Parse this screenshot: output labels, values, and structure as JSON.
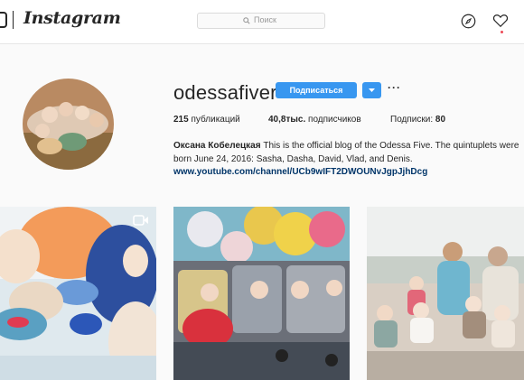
{
  "header": {
    "wordmark": "Instagram",
    "search_placeholder": "Поиск",
    "icons": [
      "compass-icon",
      "heart-icon",
      "search-icon"
    ]
  },
  "profile": {
    "username": "odessafiver",
    "follow_label": "Подписаться",
    "more_label": "···",
    "stats": {
      "posts_count": "215",
      "posts_label": "публикаций",
      "followers_count": "40,8тыс.",
      "followers_label": "подписчиков",
      "following_label": "Подписки:",
      "following_count": "80"
    },
    "bio": {
      "full_name": "Оксана Кобелецкая",
      "line1": "This is the official blog of the Odessa Five. The quintuplets were",
      "line2": "born June 24, 2016: Sasha, Dasha, David, Vlad, and Denis.",
      "link": "www.youtube.com/channel/UCb9wIFT2DWOUNvJgpJjhDcg"
    }
  },
  "colors": {
    "accent": "#3897f0",
    "link": "#003569",
    "notification": "#ed4956"
  }
}
